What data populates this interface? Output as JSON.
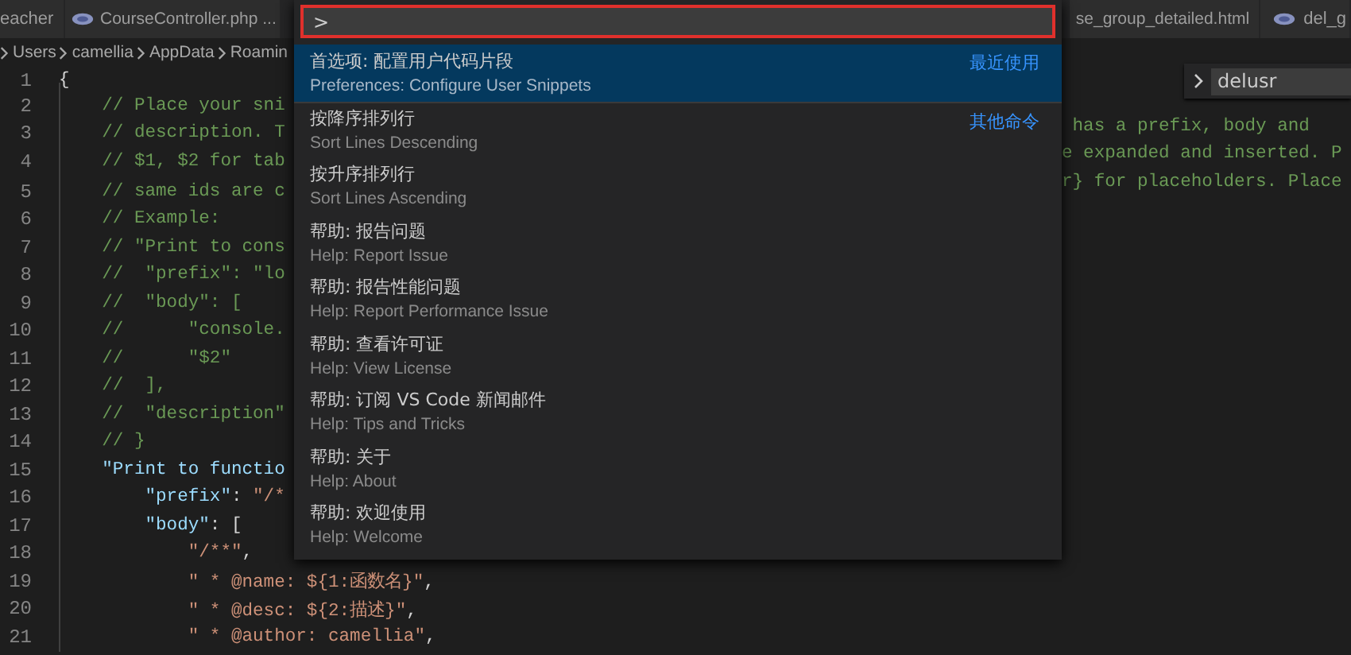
{
  "tabs": [
    {
      "label": "eacher",
      "has_icon": false
    },
    {
      "label": "CourseController.php ...",
      "has_icon": true
    },
    {
      "label": "se_group_detailed.html",
      "has_icon": false
    },
    {
      "label": "del_g",
      "has_icon": true
    }
  ],
  "breadcrumb": [
    "Users",
    "camellia",
    "AppData",
    "Roamin"
  ],
  "editor": {
    "lines": [
      {
        "number": "1",
        "left": [
          {
            "kind": "punct",
            "text": "{"
          }
        ]
      },
      {
        "number": "2",
        "left": [
          {
            "kind": "comment",
            "text": "    // Place your sni"
          }
        ],
        "right": [
          {
            "kind": "comment",
            "text": " has a prefix, body and"
          }
        ]
      },
      {
        "number": "3",
        "left": [
          {
            "kind": "comment",
            "text": "    // description. T"
          }
        ],
        "right": [
          {
            "kind": "comment",
            "text": "e expanded and inserted. P"
          }
        ]
      },
      {
        "number": "4",
        "left": [
          {
            "kind": "comment",
            "text": "    // $1, $2 for tab"
          }
        ],
        "right": [
          {
            "kind": "comment",
            "text": "r} for placeholders. Place"
          }
        ]
      },
      {
        "number": "5",
        "left": [
          {
            "kind": "comment",
            "text": "    // same ids are c"
          }
        ]
      },
      {
        "number": "6",
        "left": [
          {
            "kind": "comment",
            "text": "    // Example:"
          }
        ]
      },
      {
        "number": "7",
        "left": [
          {
            "kind": "comment",
            "text": "    // \"Print to cons"
          }
        ]
      },
      {
        "number": "8",
        "left": [
          {
            "kind": "comment",
            "text": "    //  \"prefix\": \"lo"
          }
        ]
      },
      {
        "number": "9",
        "left": [
          {
            "kind": "comment",
            "text": "    //  \"body\": ["
          }
        ]
      },
      {
        "number": "10",
        "left": [
          {
            "kind": "comment",
            "text": "    //      \"console."
          }
        ]
      },
      {
        "number": "11",
        "left": [
          {
            "kind": "comment",
            "text": "    //      \"$2\""
          }
        ]
      },
      {
        "number": "12",
        "left": [
          {
            "kind": "comment",
            "text": "    //  ],"
          }
        ]
      },
      {
        "number": "13",
        "left": [
          {
            "kind": "comment",
            "text": "    //  \"description\""
          }
        ]
      },
      {
        "number": "14",
        "left": [
          {
            "kind": "comment",
            "text": "    // }"
          }
        ]
      },
      {
        "number": "15",
        "left": [
          {
            "kind": "key",
            "text": "    \"Print to functio"
          }
        ]
      },
      {
        "number": "16",
        "left": [
          {
            "kind": "key",
            "text": "        \"prefix\""
          },
          {
            "kind": "punct",
            "text": ": "
          },
          {
            "kind": "string",
            "text": "\"/*"
          }
        ]
      },
      {
        "number": "17",
        "left": [
          {
            "kind": "key",
            "text": "        \"body\""
          },
          {
            "kind": "punct",
            "text": ": ["
          }
        ]
      },
      {
        "number": "18",
        "left": [
          {
            "kind": "string",
            "text": "            \"/**\""
          },
          {
            "kind": "punct",
            "text": ","
          }
        ]
      },
      {
        "number": "19",
        "left": [
          {
            "kind": "string",
            "text": "            \" * @name: ${1:函数名}\""
          },
          {
            "kind": "punct",
            "text": ","
          }
        ]
      },
      {
        "number": "20",
        "left": [
          {
            "kind": "string",
            "text": "            \" * @desc: ${2:描述}\""
          },
          {
            "kind": "punct",
            "text": ","
          }
        ]
      },
      {
        "number": "21",
        "left": [
          {
            "kind": "string",
            "text": "            \" * @author: camellia\""
          },
          {
            "kind": "punct",
            "text": ","
          }
        ]
      }
    ]
  },
  "command_palette": {
    "input": {
      "value": ">"
    },
    "items": [
      {
        "label": "首选项: 配置用户代码片段",
        "detail": "Preferences: Configure User Snippets",
        "group": "最近使用",
        "selected": true
      },
      {
        "label": "按降序排列行",
        "detail": "Sort Lines Descending",
        "group": "其他命令",
        "selected": false
      },
      {
        "label": "按升序排列行",
        "detail": "Sort Lines Ascending",
        "selected": false
      },
      {
        "label": "帮助: 报告问题",
        "detail": "Help: Report Issue",
        "selected": false
      },
      {
        "label": "帮助: 报告性能问题",
        "detail": "Help: Report Performance Issue",
        "selected": false
      },
      {
        "label": "帮助: 查看许可证",
        "detail": "Help: View License",
        "selected": false
      },
      {
        "label": "帮助: 订阅 VS Code 新闻邮件",
        "detail": "Help: Tips and Tricks",
        "selected": false
      },
      {
        "label": "帮助: 关于",
        "detail": "Help: About",
        "selected": false
      },
      {
        "label": "帮助: 欢迎使用",
        "detail": "Help: Welcome",
        "selected": false
      }
    ]
  },
  "find_widget": {
    "value": "delusr"
  }
}
